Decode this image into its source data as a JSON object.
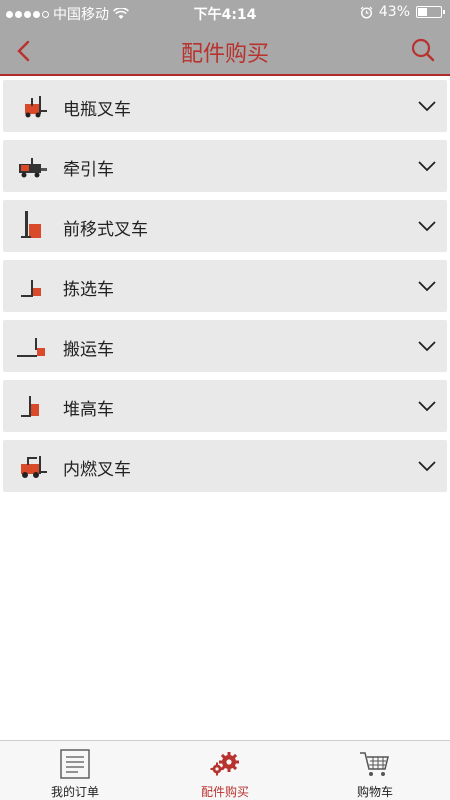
{
  "status_bar": {
    "carrier": "中国移动",
    "time": "下午4:14",
    "battery": "43%",
    "battery_level": 0.43
  },
  "nav": {
    "title": "配件购买"
  },
  "categories": [
    {
      "label": "电瓶叉车",
      "icon": "electric-forklift-icon"
    },
    {
      "label": "牵引车",
      "icon": "tow-tractor-icon"
    },
    {
      "label": "前移式叉车",
      "icon": "reach-truck-icon"
    },
    {
      "label": "拣选车",
      "icon": "order-picker-icon"
    },
    {
      "label": "搬运车",
      "icon": "pallet-truck-icon"
    },
    {
      "label": "堆高车",
      "icon": "stacker-icon"
    },
    {
      "label": "内燃叉车",
      "icon": "ic-forklift-icon"
    }
  ],
  "tabs": [
    {
      "label": "我的订单",
      "icon": "orders-icon"
    },
    {
      "label": "配件购买",
      "icon": "gears-icon",
      "active": true
    },
    {
      "label": "购物车",
      "icon": "cart-icon"
    }
  ],
  "colors": {
    "accent": "#b8322e",
    "header_bg": "#a8a8a8",
    "row_bg": "#e9e9e9"
  }
}
